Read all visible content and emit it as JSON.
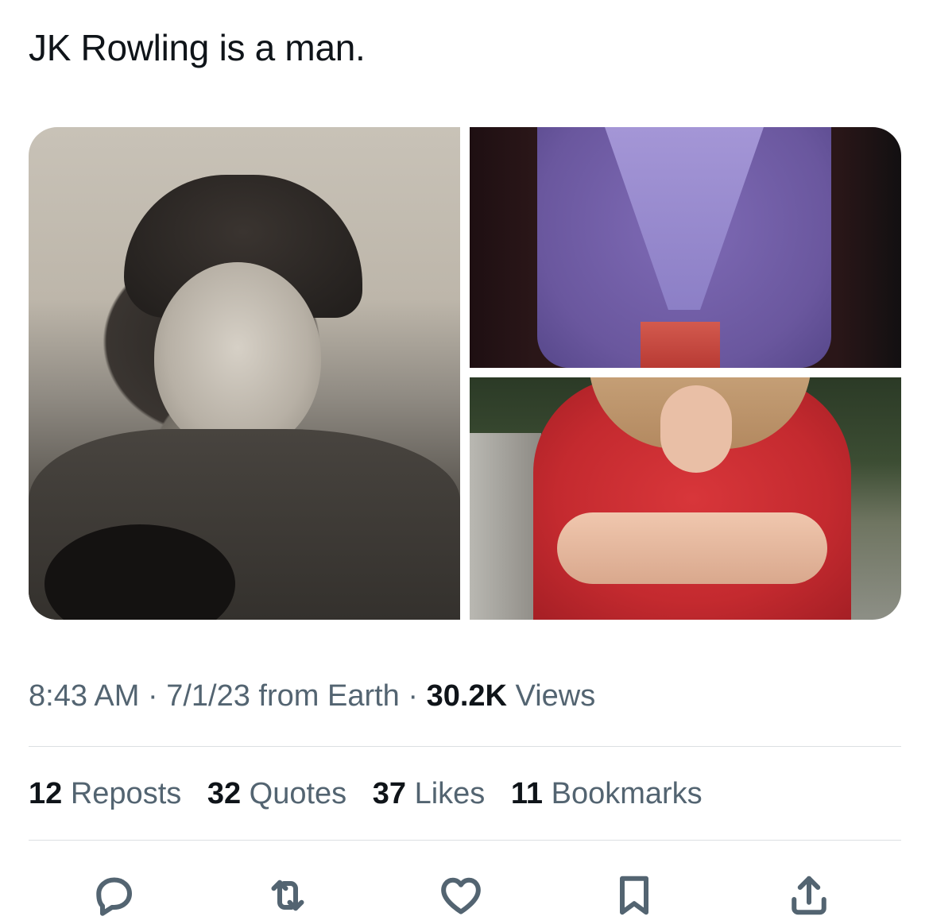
{
  "tweet": {
    "text": "JK Rowling is a man."
  },
  "meta": {
    "time": "8:43 AM",
    "sep1": "·",
    "date_source": "7/1/23 from Earth",
    "sep2": "·",
    "views_count": "30.2K",
    "views_label": "Views"
  },
  "stats": [
    {
      "count": "12",
      "label": "Reposts"
    },
    {
      "count": "32",
      "label": "Quotes"
    },
    {
      "count": "37",
      "label": "Likes"
    },
    {
      "count": "11",
      "label": "Bookmarks"
    }
  ],
  "actions": {
    "reply": "reply-icon",
    "repost": "repost-icon",
    "like": "heart-icon",
    "bookmark": "bookmark-icon",
    "share": "share-icon"
  },
  "colors": {
    "text_primary": "#0f1419",
    "text_secondary": "#536471",
    "divider": "#dcdfe2"
  }
}
